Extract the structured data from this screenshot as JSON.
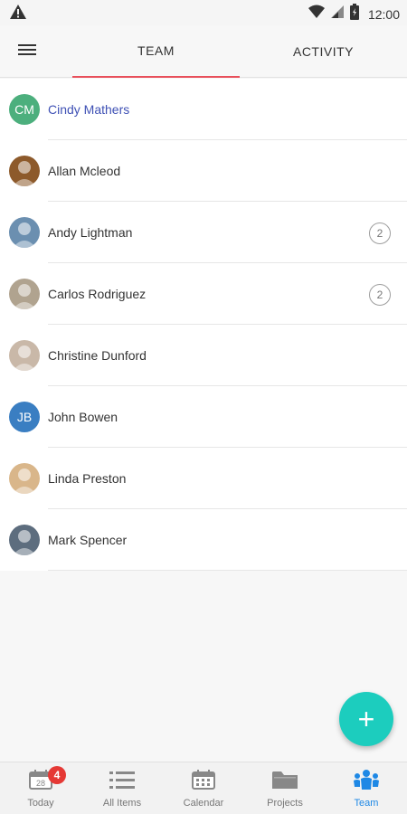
{
  "status_bar": {
    "time": "12:00"
  },
  "tabs": [
    {
      "label": "TEAM",
      "active": true
    },
    {
      "label": "ACTIVITY",
      "active": false
    }
  ],
  "members": [
    {
      "name": "Cindy Mathers",
      "initials": "CM",
      "avatar_color": "#4caf7d",
      "badge": "",
      "highlight": true
    },
    {
      "name": "Allan Mcleod",
      "initials": "",
      "avatar_color": "#8d5a2b",
      "badge": ""
    },
    {
      "name": "Andy Lightman",
      "initials": "",
      "avatar_color": "#6b8fb0",
      "badge": "2"
    },
    {
      "name": "Carlos Rodriguez",
      "initials": "",
      "avatar_color": "#b0a38f",
      "badge": "2"
    },
    {
      "name": "Christine Dunford",
      "initials": "",
      "avatar_color": "#c9b8a8",
      "badge": ""
    },
    {
      "name": "John Bowen",
      "initials": "JB",
      "avatar_color": "#3a7ec2",
      "badge": ""
    },
    {
      "name": "Linda Preston",
      "initials": "",
      "avatar_color": "#d9b68a",
      "badge": ""
    },
    {
      "name": "Mark Spencer",
      "initials": "",
      "avatar_color": "#5d6d7e",
      "badge": ""
    }
  ],
  "fab": {
    "symbol": "+"
  },
  "bottom_nav": [
    {
      "label": "Today",
      "icon": "calendar-day-icon",
      "badge": "4",
      "day": "28"
    },
    {
      "label": "All Items",
      "icon": "list-icon"
    },
    {
      "label": "Calendar",
      "icon": "calendar-icon"
    },
    {
      "label": "Projects",
      "icon": "folder-icon"
    },
    {
      "label": "Team",
      "icon": "team-icon",
      "active": true
    }
  ],
  "colors": {
    "accent": "#1ccdbe",
    "tab_indicator": "#e8505b",
    "active_nav": "#1e88e5"
  }
}
